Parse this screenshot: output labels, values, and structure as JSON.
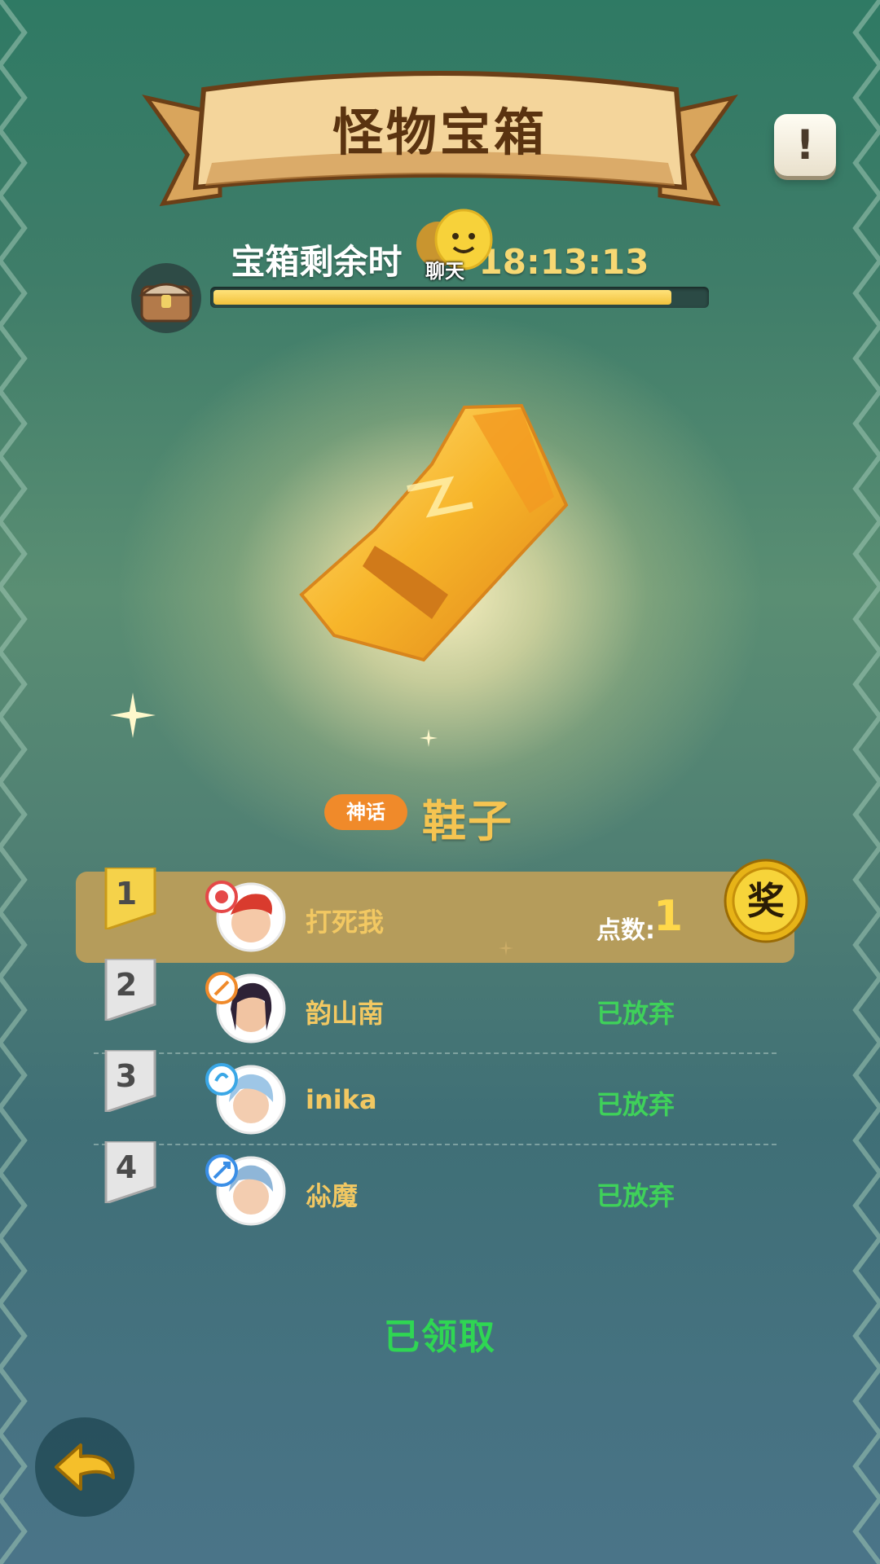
{
  "header": {
    "title": "怪物宝箱",
    "info_icon": "exclamation-icon"
  },
  "timer": {
    "label": "宝箱剩余时",
    "value": "18:13:13",
    "progress_fraction": 0.93
  },
  "chat": {
    "label": "聊天"
  },
  "item": {
    "rarity": "神话",
    "name": "鞋子",
    "icon": "golden-boot-icon"
  },
  "ranking": [
    {
      "rank": "1",
      "name": "打死我",
      "points_label": "点数:",
      "points_value": "1",
      "status": "",
      "class_color": "#e54848"
    },
    {
      "rank": "2",
      "name": "韵山南",
      "points_label": "",
      "points_value": "",
      "status": "已放弃",
      "class_color": "#f08a2a"
    },
    {
      "rank": "3",
      "name": "inika",
      "points_label": "",
      "points_value": "",
      "status": "已放弃",
      "class_color": "#3aa7e6"
    },
    {
      "rank": "4",
      "name": "尛魔",
      "points_label": "",
      "points_value": "",
      "status": "已放弃",
      "class_color": "#3a8ee6"
    }
  ],
  "reward_badge": "奖",
  "footer": {
    "claimed_label": "已领取"
  },
  "colors": {
    "accent_gold": "#f5c451",
    "status_green": "#3fd15a",
    "rarity_orange": "#f08a2a"
  }
}
